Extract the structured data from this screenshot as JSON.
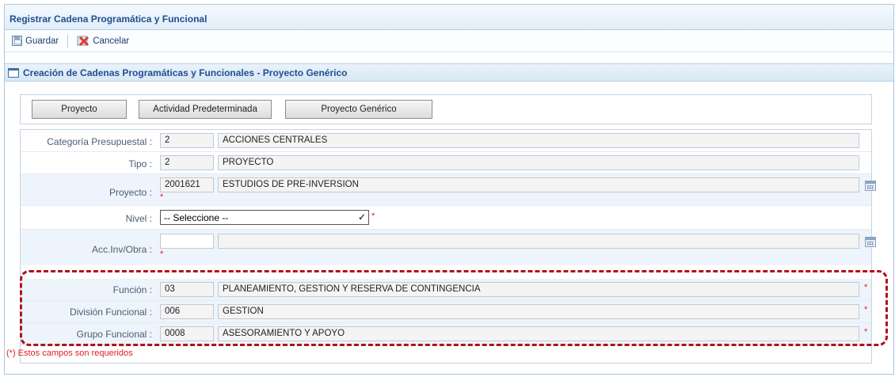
{
  "window": {
    "title": "Registrar Cadena Programática y Funcional"
  },
  "toolbar": {
    "save_label": "Guardar",
    "cancel_label": "Cancelar"
  },
  "section": {
    "title": "Creación de Cadenas Programáticas y Funcionales - Proyecto Genérico"
  },
  "tabs": [
    {
      "label": "Proyecto"
    },
    {
      "label": "Actividad Predeterminada"
    },
    {
      "label": "Proyecto Genérico"
    }
  ],
  "form": {
    "categoria": {
      "label": "Categoría Presupuestal :",
      "code": "2",
      "desc": "ACCIONES CENTRALES"
    },
    "tipo": {
      "label": "Tipo :",
      "code": "2",
      "desc": "PROYECTO"
    },
    "proyecto": {
      "label": "Proyecto :",
      "code": "2001621",
      "desc": "ESTUDIOS DE PRE-INVERSION"
    },
    "nivel": {
      "label": "Nivel :",
      "selected": "-- Seleccione --"
    },
    "accinv": {
      "label": "Acc.Inv/Obra :",
      "code": "",
      "desc": ""
    },
    "funcion": {
      "label": "Función :",
      "code": "03",
      "desc": "PLANEAMIENTO, GESTION Y RESERVA DE CONTINGENCIA"
    },
    "division": {
      "label": "División Funcional :",
      "code": "006",
      "desc": "GESTION"
    },
    "grupo": {
      "label": "Grupo Funcional :",
      "code": "0008",
      "desc": "ASESORAMIENTO Y APOYO"
    },
    "required_mark": "*",
    "required_note": "(*) Estos campos son requeridos"
  },
  "colors": {
    "accent": "#1d4f91",
    "required": "#e02020",
    "highlight": "#b0121a"
  }
}
